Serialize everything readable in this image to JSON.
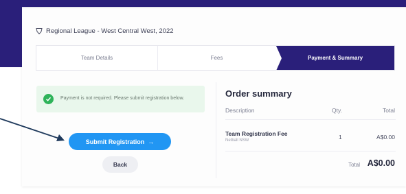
{
  "header": {
    "title": "Regional League - West Central West, 2022",
    "icon": "shield-icon"
  },
  "stepper": {
    "steps": [
      {
        "label": "Team Details",
        "active": false
      },
      {
        "label": "Fees",
        "active": false
      },
      {
        "label": "Payment & Summary",
        "active": true
      }
    ]
  },
  "alert": {
    "text": "Payment is not required. Please submit registration below.",
    "icon": "check-circle-icon"
  },
  "actions": {
    "submit_label": "Submit Registration",
    "submit_arrow": "→",
    "back_label": "Back"
  },
  "order_summary": {
    "title": "Order summary",
    "columns": [
      "Description",
      "Qty.",
      "Total"
    ],
    "items": [
      {
        "name": "Team Registration Fee",
        "sub": "Netball NSW",
        "qty": "1",
        "total": "A$0.00"
      }
    ],
    "total_label": "Total",
    "total_value": "A$0.00"
  },
  "colors": {
    "brand": "#2a1f7a",
    "primary_button": "#2196f3",
    "success": "#2fb35a",
    "alert_bg": "#e9f7ec"
  }
}
